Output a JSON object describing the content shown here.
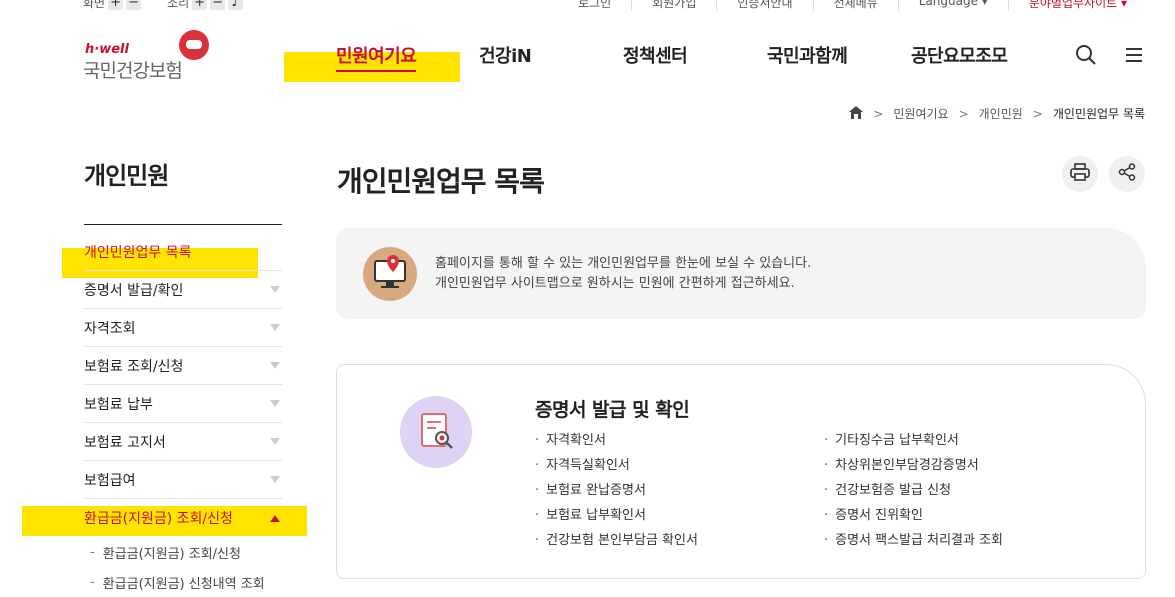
{
  "util": {
    "font_label": "화면",
    "sound_label": "소리",
    "plus": "+",
    "minus": "−",
    "links": [
      "로그인",
      "회원가입",
      "인증서안내",
      "전체메뉴",
      "Language ▾",
      "분야별업무사이트 ▾"
    ]
  },
  "logo": {
    "brand": "h·well",
    "name": "국민건강보험"
  },
  "gnb": {
    "items": [
      "민원여기요",
      "건강iN",
      "정책센터",
      "국민과함께",
      "공단요모조모"
    ]
  },
  "breadcrumb": {
    "items": [
      "민원여기요",
      "개인민원",
      "개인민원업무 목록"
    ]
  },
  "lnb": {
    "title": "개인민원",
    "items": [
      "개인민원업무 목록",
      "증명서 발급/확인",
      "자격조회",
      "보험료 조회/신청",
      "보험료 납부",
      "보험료 고지서",
      "보험급여",
      "환급금(지원금) 조회/신청"
    ],
    "subitems": [
      "환급금(지원금) 조회/신청",
      "환급금(지원금) 신청내역 조회"
    ]
  },
  "main": {
    "title": "개인민원업무 목록",
    "info_line1": "홈페이지를 통해 할 수 있는 개인민원업무를 한눈에 보실 수 있습니다.",
    "info_line2": "개인민원업무 사이트맵으로 원하시는 민원에 간편하게 접근하세요."
  },
  "card": {
    "title": "증명서 발급 및 확인",
    "left": [
      "자격확인서",
      "자격득실확인서",
      "보험료 완납증명서",
      "보험료 납부확인서",
      "건강보험 본인부담금 확인서"
    ],
    "right": [
      "기타징수금 납부확인서",
      "차상위본인부담경감증명서",
      "건강보험증 발급 신청",
      "증명서 진위확인",
      "증명서 팩스발급 처리결과 조회"
    ]
  },
  "colors": {
    "accent": "#c8102e",
    "highlight": "#ffe400"
  }
}
